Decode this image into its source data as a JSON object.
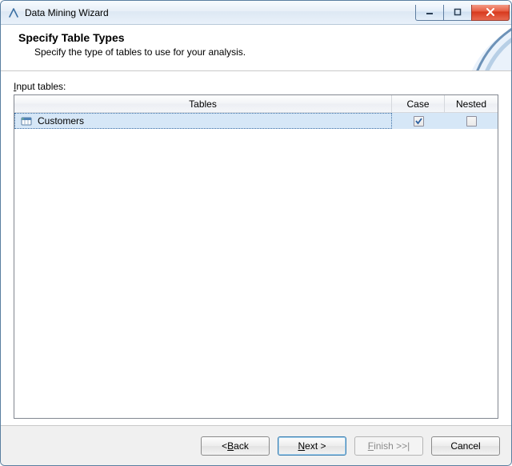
{
  "window": {
    "title": "Data Mining Wizard"
  },
  "header": {
    "title": "Specify Table Types",
    "subtitle": "Specify the type of tables to use for your analysis."
  },
  "inputTables": {
    "label_prefix": "I",
    "label_rest": "nput tables:",
    "columns": {
      "tables": "Tables",
      "case": "Case",
      "nested": "Nested"
    },
    "rows": [
      {
        "name": "Customers",
        "case": true,
        "nested": false,
        "icon": "table-icon",
        "selected": true
      }
    ]
  },
  "buttons": {
    "back_prefix": "< ",
    "back_ul": "B",
    "back_rest": "ack",
    "next_ul": "N",
    "next_rest": "ext >",
    "finish_ul": "F",
    "finish_rest": "inish >>|",
    "cancel": "Cancel"
  }
}
